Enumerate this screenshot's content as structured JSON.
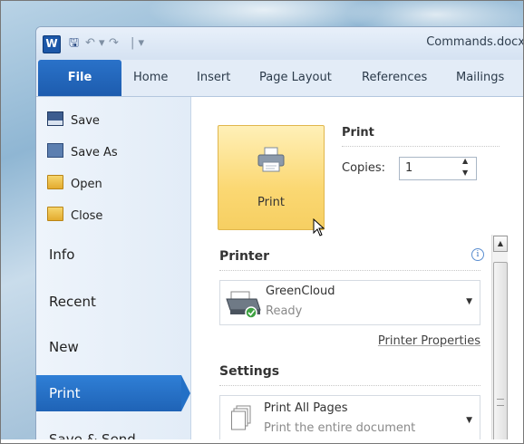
{
  "window": {
    "title": "Commands.docx",
    "app_icon_letter": "W",
    "quick_access": {
      "save": "🖫",
      "undo": "↶ ▾",
      "redo": "↷",
      "customize": "| ▾"
    }
  },
  "ribbon": {
    "tabs": [
      {
        "label": "File",
        "selected": true
      },
      {
        "label": "Home"
      },
      {
        "label": "Insert"
      },
      {
        "label": "Page Layout"
      },
      {
        "label": "References"
      },
      {
        "label": "Mailings"
      }
    ]
  },
  "backstage": {
    "commands": [
      {
        "label": "Save",
        "icon": "save-icon"
      },
      {
        "label": "Save As",
        "icon": "save-as-icon"
      },
      {
        "label": "Open",
        "icon": "open-folder-icon"
      },
      {
        "label": "Close",
        "icon": "close-folder-icon"
      }
    ],
    "nav": [
      {
        "label": "Info"
      },
      {
        "label": "Recent"
      },
      {
        "label": "New"
      },
      {
        "label": "Print",
        "selected": true
      },
      {
        "label": "Save & Send"
      }
    ]
  },
  "print_pane": {
    "print_button_label": "Print",
    "print_heading": "Print",
    "copies_label": "Copies:",
    "copies_value": "1",
    "printer_heading": "Printer",
    "printer": {
      "name": "GreenCloud",
      "status": "Ready"
    },
    "printer_properties_link": "Printer Properties",
    "settings_heading": "Settings",
    "pages_setting": {
      "name": "Print All Pages",
      "description": "Print the entire document"
    }
  },
  "colors": {
    "file_tab": "#1d5cae",
    "print_nav_selected": "#2370c6",
    "print_button": "#fbd873"
  }
}
